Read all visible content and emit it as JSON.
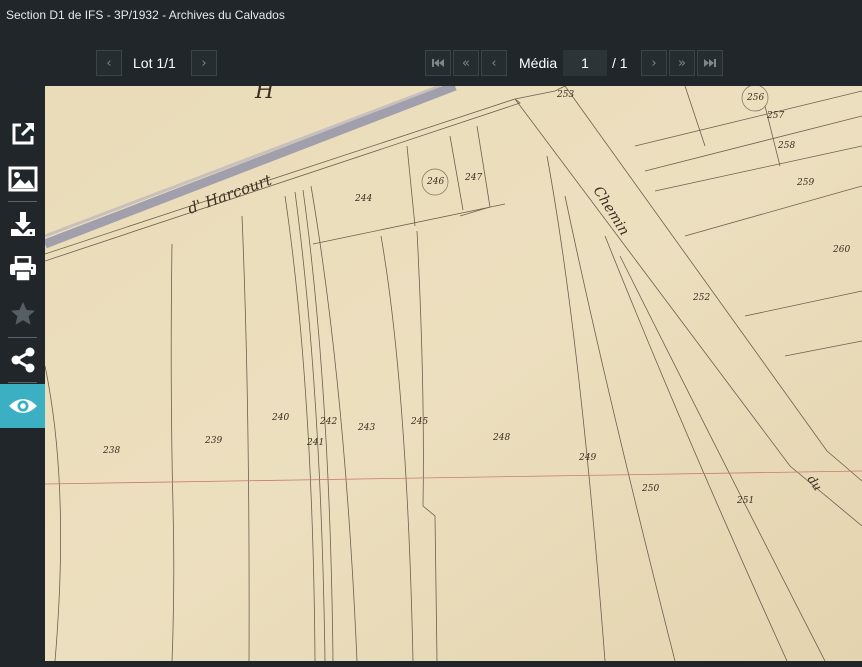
{
  "window": {
    "title": "Section D1 de IFS - 3P/1932 - Archives du Calvados"
  },
  "lot_nav": {
    "label": "Lot 1/1",
    "prev_icon": "chevron-left-icon",
    "next_icon": "chevron-right-icon"
  },
  "media_nav": {
    "label": "Média",
    "current_page": "1",
    "total": "/ 1",
    "first_icon": "first-page-icon",
    "fast_back_icon": "double-chevron-left-icon",
    "prev_icon": "chevron-left-icon",
    "next_icon": "chevron-right-icon",
    "fast_forward_icon": "double-chevron-right-icon",
    "last_icon": "last-page-icon"
  },
  "sidebar": {
    "items": [
      {
        "icon": "external-link-icon",
        "active": false
      },
      {
        "icon": "image-icon",
        "active": false
      },
      {
        "icon": "download-icon",
        "active": false
      },
      {
        "icon": "print-icon",
        "active": false
      },
      {
        "icon": "star-icon",
        "active": false
      },
      {
        "icon": "share-icon",
        "active": false
      },
      {
        "icon": "eye-icon",
        "active": true
      }
    ],
    "active_color": "#3ab0c2"
  },
  "map": {
    "street_labels": [
      "d' Harcourt",
      "Chemin",
      "du"
    ],
    "parcels": [
      "238",
      "239",
      "240",
      "241",
      "242",
      "243",
      "244",
      "245",
      "246",
      "247",
      "248",
      "249",
      "250",
      "251",
      "252",
      "253",
      "256",
      "257",
      "258",
      "259",
      "260"
    ]
  }
}
